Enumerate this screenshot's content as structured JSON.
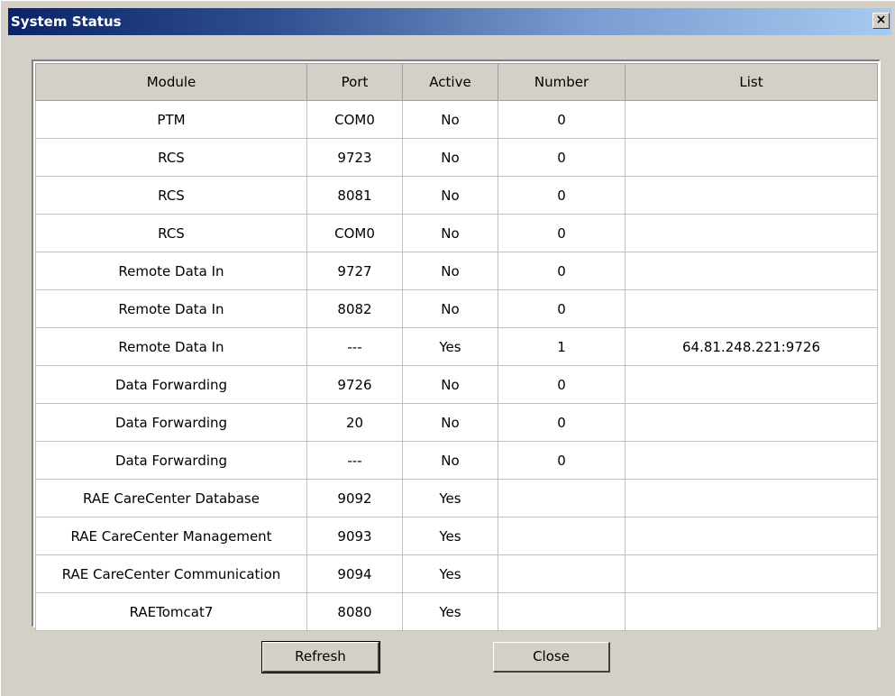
{
  "window": {
    "title": "System Status",
    "close_glyph": "×",
    "close_icon": "close-icon"
  },
  "table": {
    "columns": [
      "Module",
      "Port",
      "Active",
      "Number",
      "List"
    ],
    "rows": [
      [
        "PTM",
        "COM0",
        "No",
        "0",
        ""
      ],
      [
        "RCS",
        "9723",
        "No",
        "0",
        ""
      ],
      [
        "RCS",
        "8081",
        "No",
        "0",
        ""
      ],
      [
        "RCS",
        "COM0",
        "No",
        "0",
        ""
      ],
      [
        "Remote Data In",
        "9727",
        "No",
        "0",
        ""
      ],
      [
        "Remote Data In",
        "8082",
        "No",
        "0",
        ""
      ],
      [
        "Remote Data In",
        "---",
        "Yes",
        "1",
        "64.81.248.221:9726"
      ],
      [
        "Data Forwarding",
        "9726",
        "No",
        "0",
        ""
      ],
      [
        "Data Forwarding",
        "20",
        "No",
        "0",
        ""
      ],
      [
        "Data Forwarding",
        "---",
        "No",
        "0",
        ""
      ],
      [
        "RAE CareCenter Database",
        "9092",
        "Yes",
        "",
        ""
      ],
      [
        "RAE CareCenter Management",
        "9093",
        "Yes",
        "",
        ""
      ],
      [
        "RAE CareCenter Communication",
        "9094",
        "Yes",
        "",
        ""
      ],
      [
        "RAETomcat7",
        "8080",
        "Yes",
        "",
        ""
      ]
    ]
  },
  "buttons": {
    "refresh_label": "Refresh",
    "close_label": "Close"
  },
  "colors": {
    "titlebar_start": "#0a246a",
    "titlebar_end": "#a6caf0",
    "dialog_bg": "#d4d0c8"
  }
}
